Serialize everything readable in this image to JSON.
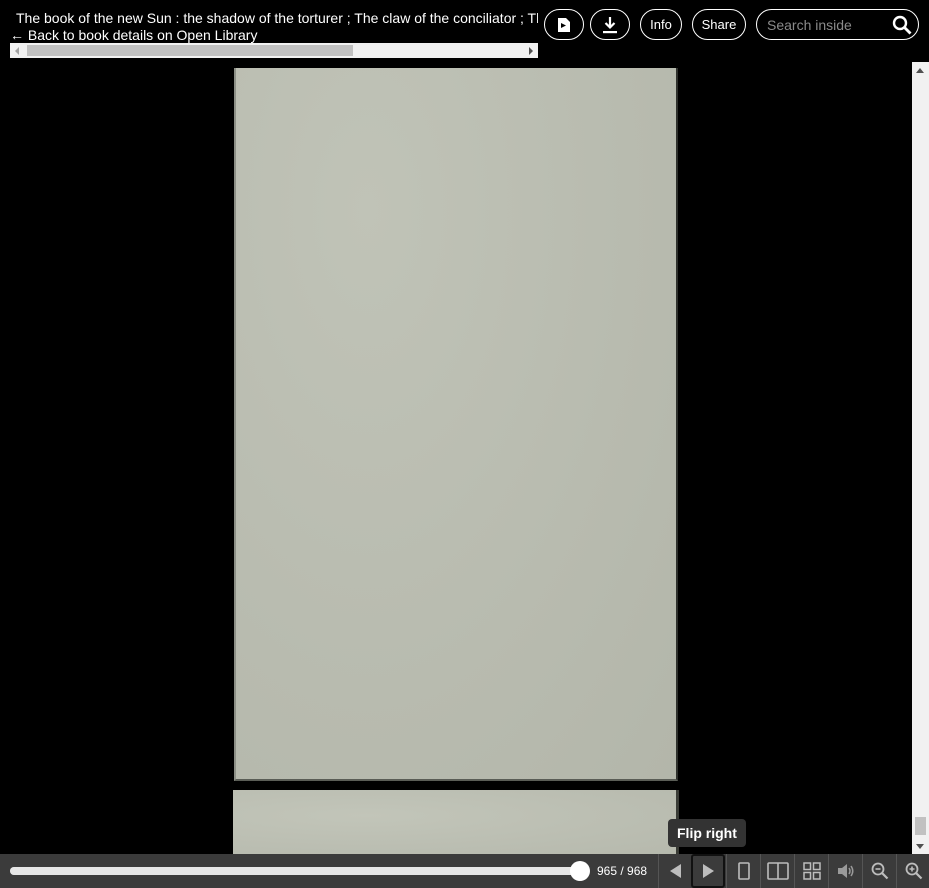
{
  "header": {
    "title": "The book of the new Sun : the shadow of the torturer ; The claw of the conciliator ; The sword of the lictor ; The citadel of the autarch",
    "back_link": "← Back to book details on Open Library",
    "buttons": {
      "page_icon": "page-view-icon",
      "download_icon": "download-icon",
      "info": "Info",
      "share": "Share"
    },
    "search": {
      "placeholder": "Search inside",
      "icon": "search-icon"
    }
  },
  "viewer": {
    "page_color": "#b9bcb0",
    "background": "#000000"
  },
  "tooltip": {
    "text": "Flip right"
  },
  "toolbar": {
    "page_indicator": "965 / 968",
    "current_page": 965,
    "total_pages": 968,
    "progress": 0.9969,
    "buttons": [
      {
        "name": "flip-left-button",
        "icon": "triangle-left-icon"
      },
      {
        "name": "flip-right-button",
        "icon": "triangle-right-icon"
      },
      {
        "name": "one-page-view-button",
        "icon": "single-page-icon"
      },
      {
        "name": "two-page-view-button",
        "icon": "two-page-icon"
      },
      {
        "name": "thumbnail-view-button",
        "icon": "grid-icon"
      },
      {
        "name": "read-aloud-button",
        "icon": "speaker-icon"
      },
      {
        "name": "zoom-out-button",
        "icon": "zoom-out-icon"
      },
      {
        "name": "zoom-in-button",
        "icon": "zoom-in-icon"
      }
    ]
  }
}
